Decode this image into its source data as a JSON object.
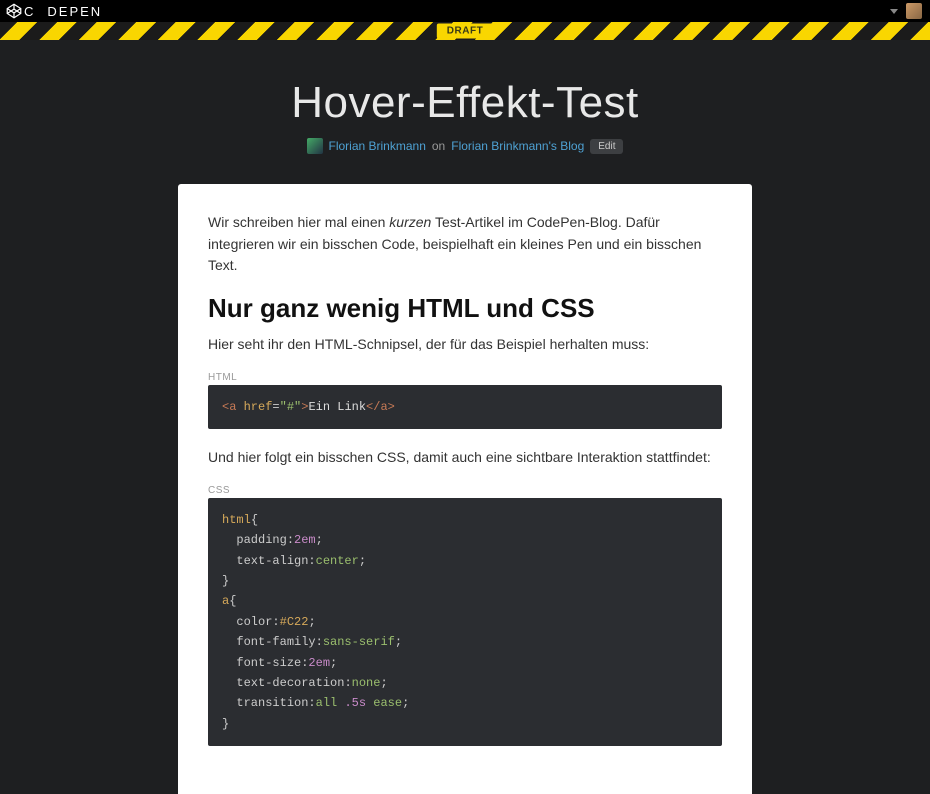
{
  "brand": "CODEPEN",
  "draft_label": "DRAFT",
  "post_title": "Hover-Effekt-Test",
  "author_name": "Florian Brinkmann",
  "byline_on": "on",
  "blog_name": "Florian Brinkmann's Blog",
  "edit_label": "Edit",
  "intro_prefix": "Wir schreiben hier mal einen ",
  "intro_em": "kurzen",
  "intro_suffix": " Test-Artikel im CodePen-Blog. Dafür integrieren wir ein bisschen Code, beispielhaft ein kleines Pen und ein bisschen Text.",
  "section_heading": "Nur ganz wenig HTML und CSS",
  "html_intro": "Hier seht ihr den HTML-Schnipsel, der für das Beispiel herhalten muss:",
  "html_label": "HTML",
  "html_code": {
    "open_tag": "<a",
    "attr": " href",
    "eq": "=",
    "val": "\"#\"",
    "gt": ">",
    "text": "Ein Link",
    "close_tag": "</a>"
  },
  "css_intro": "Und hier folgt ein bisschen CSS, damit auch eine sichtbare Interaktion stattfindet:",
  "css_label": "CSS",
  "css": {
    "l1_sel": "html",
    "l1_brace": "{",
    "l2_prop": "padding",
    "l2_val": "2em",
    "l3_prop": "text-align",
    "l3_val": "center",
    "l4_brace": "}",
    "l5_sel": "a",
    "l5_brace": "{",
    "l6_prop": "color",
    "l6_val": "#C22",
    "l7_prop": "font-family",
    "l7_val": "sans-serif",
    "l8_prop": "font-size",
    "l8_val": "2em",
    "l9_prop": "text-decoration",
    "l9_val": "none",
    "l10_prop": "transition",
    "l10_val1": "all",
    "l10_val2": ".5s",
    "l10_val3": "ease",
    "l11_brace": "}",
    "colon": ":",
    "semi": ";",
    "sp": " "
  }
}
